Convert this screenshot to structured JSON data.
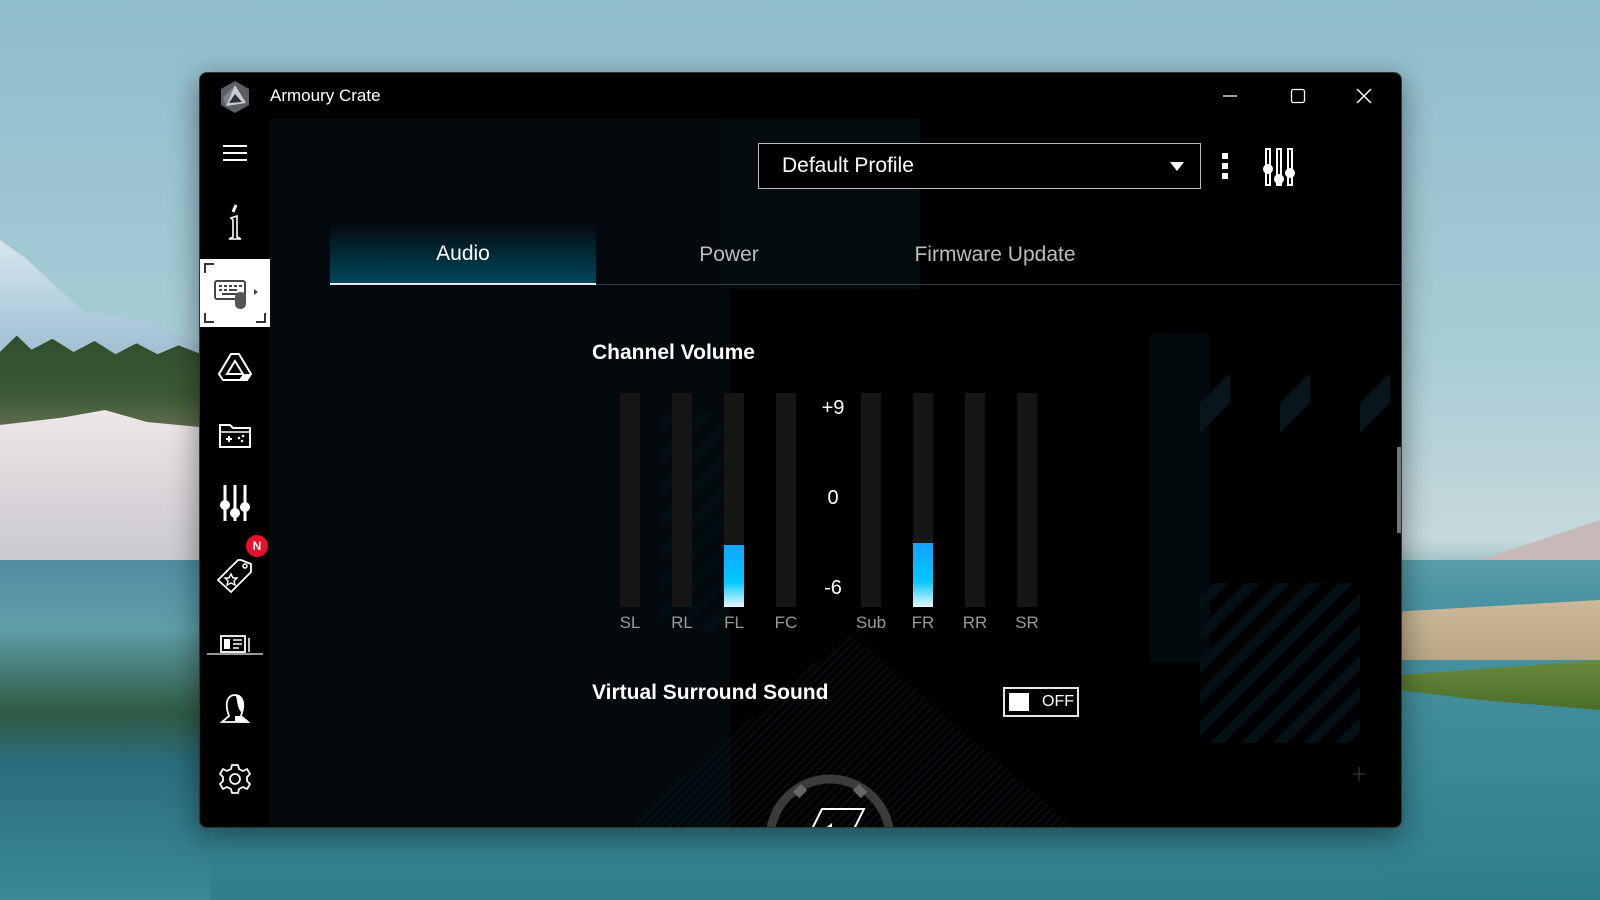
{
  "window": {
    "title": "Armoury Crate",
    "controls": {
      "minimize": "minimize",
      "maximize": "maximize",
      "close": "close"
    }
  },
  "sidebar": {
    "items": [
      {
        "name": "menu",
        "icon": "hamburger-menu-icon"
      },
      {
        "name": "system-info",
        "icon": "info-icon"
      },
      {
        "name": "devices",
        "icon": "keyboard-mouse-icon",
        "active": true
      },
      {
        "name": "aura-sync",
        "icon": "aura-triangle-icon"
      },
      {
        "name": "game-library",
        "icon": "game-folder-icon"
      },
      {
        "name": "scenario-profiles",
        "icon": "sliders-icon"
      },
      {
        "name": "deals",
        "icon": "tag-star-icon",
        "badge": "N"
      },
      {
        "name": "news",
        "icon": "news-icon"
      },
      {
        "name": "user-center",
        "icon": "user-icon"
      },
      {
        "name": "settings",
        "icon": "gear-icon"
      }
    ]
  },
  "header": {
    "profile_select": {
      "value": "Default Profile"
    }
  },
  "tabs": [
    {
      "label": "Audio",
      "active": true
    },
    {
      "label": "Power",
      "active": false
    },
    {
      "label": "Firmware Update",
      "active": false
    }
  ],
  "channel_volume": {
    "title": "Channel Volume",
    "scale": {
      "max": "+9",
      "mid": "0",
      "min": "-6"
    },
    "range": [
      -6,
      9
    ],
    "channels": [
      {
        "label": "SL",
        "level": null
      },
      {
        "label": "RL",
        "level": null
      },
      {
        "label": "FL",
        "level": 0.29
      },
      {
        "label": "FC",
        "level": null
      },
      {
        "label": "Sub",
        "level": null
      },
      {
        "label": "FR",
        "level": 0.3
      },
      {
        "label": "RR",
        "level": null
      },
      {
        "label": "SR",
        "level": null
      }
    ]
  },
  "virtual_surround": {
    "title": "Virtual Surround Sound",
    "toggle_state": "OFF",
    "enabled": false
  },
  "colors": {
    "accent": "#03c8ff",
    "badge": "#e8102a",
    "active_tab": "#00475b"
  }
}
